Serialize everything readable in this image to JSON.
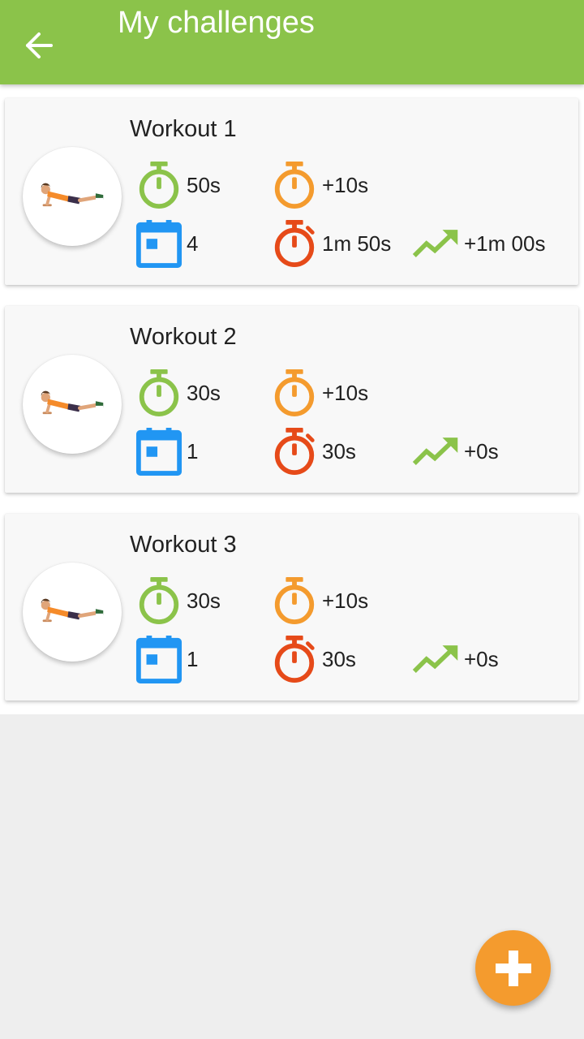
{
  "app_bar": {
    "title": "My challenges",
    "back_icon": "arrow-back-icon",
    "color": "#8bc34a"
  },
  "colors": {
    "green": "#8bc34a",
    "orange": "#f49b2e",
    "red": "#e64a19",
    "blue": "#2196f3"
  },
  "workouts": [
    {
      "title": "Workout 1",
      "initial_time": "50s",
      "increment": "+10s",
      "days": "4",
      "current_time": "1m 50s",
      "progress": "+1m 00s"
    },
    {
      "title": "Workout 2",
      "initial_time": "30s",
      "increment": "+10s",
      "days": "1",
      "current_time": "30s",
      "progress": "+0s"
    },
    {
      "title": "Workout 3",
      "initial_time": "30s",
      "increment": "+10s",
      "days": "1",
      "current_time": "30s",
      "progress": "+0s"
    }
  ],
  "fab": {
    "icon": "plus-icon"
  }
}
